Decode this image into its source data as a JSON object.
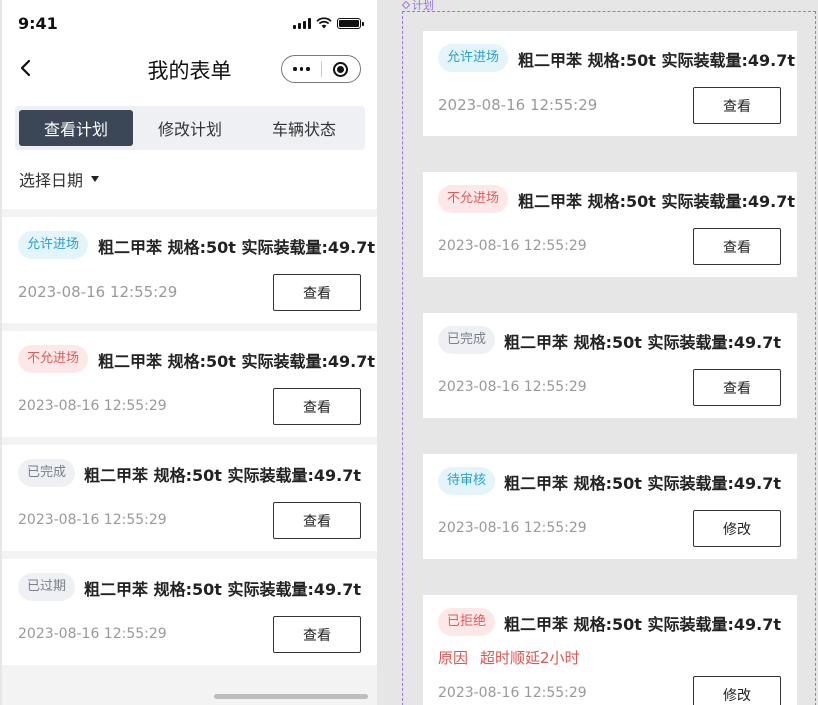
{
  "status_bar": {
    "time": "9:41"
  },
  "nav": {
    "title": "我的表单"
  },
  "tabs": [
    {
      "label": "查看计划",
      "active": true
    },
    {
      "label": "修改计划",
      "active": false
    },
    {
      "label": "车辆状态",
      "active": false
    }
  ],
  "date_filter": {
    "label": "选择日期"
  },
  "list": [
    {
      "status": "允许进场",
      "title": "粗二甲苯  规格:50t 实际装载量:49.7t",
      "date": "2023-08-16 12:55:29",
      "action": "查看"
    },
    {
      "status": "不允进场",
      "title": "粗二甲苯  规格:50t 实际装载量:49.7t",
      "date": "2023-08-16 12:55:29",
      "action": "查看"
    },
    {
      "status": "已完成",
      "title": "粗二甲苯  规格:50t 实际装载量:49.7t",
      "date": "2023-08-16 12:55:29",
      "action": "查看"
    },
    {
      "status": "已过期",
      "title": "粗二甲苯  规格:50t 实际装载量:49.7t",
      "date": "2023-08-16 12:55:29",
      "action": "查看"
    }
  ],
  "board": {
    "label": "计划",
    "cards": [
      {
        "status": "允许进场",
        "title": "粗二甲苯  规格:50t 实际装载量:49.7t",
        "date": "2023-08-16 12:55:29",
        "action": "查看"
      },
      {
        "status": "不允进场",
        "title": "粗二甲苯  规格:50t 实际装载量:49.7t",
        "date": "2023-08-16 12:55:29",
        "action": "查看"
      },
      {
        "status": "已完成",
        "title": "粗二甲苯  规格:50t 实际装载量:49.7t",
        "date": "2023-08-16 12:55:29",
        "action": "查看"
      },
      {
        "status": "待审核",
        "title": "粗二甲苯  规格:50t 实际装载量:49.7t",
        "date": "2023-08-16 12:55:29",
        "action": "修改"
      },
      {
        "status": "已拒绝",
        "title": "粗二甲苯  规格:50t 实际装载量:49.7t",
        "reason_label": "原因",
        "reason_text": "超时顺延2小时",
        "date": "2023-08-16 12:55:29",
        "action": "修改"
      }
    ]
  },
  "colors": {
    "tab_active_bg": "#3b4656",
    "tag_allow": "#2aa0cf",
    "tag_deny": "#e05b5b",
    "tag_neutral": "#7b818c",
    "reason": "#e0554f",
    "board_border": "#9c73e8"
  }
}
